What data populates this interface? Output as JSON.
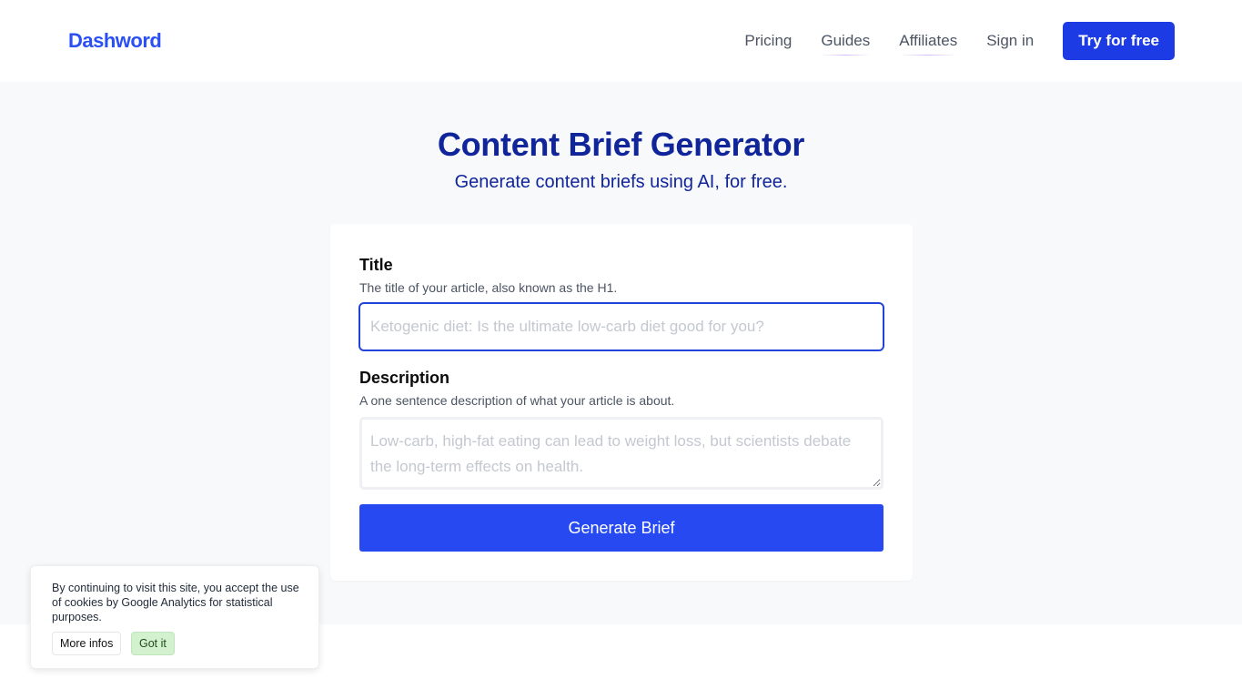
{
  "header": {
    "logo": "Dashword",
    "nav": [
      {
        "label": "Pricing"
      },
      {
        "label": "Guides"
      },
      {
        "label": "Affiliates"
      },
      {
        "label": "Sign in"
      }
    ],
    "cta": "Try for free"
  },
  "hero": {
    "title": "Content Brief Generator",
    "subtitle": "Generate content briefs using AI, for free."
  },
  "form": {
    "title_label": "Title",
    "title_hint": "The title of your article, also known as the H1.",
    "title_placeholder": "Ketogenic diet: Is the ultimate low-carb diet good for you?",
    "title_value": "",
    "description_label": "Description",
    "description_hint": "A one sentence description of what your article is about.",
    "description_placeholder": "Low-carb, high-fat eating can lead to weight loss, but scientists debate the long-term effects on health.",
    "description_value": "",
    "submit": "Generate Brief"
  },
  "cookie": {
    "text": "By continuing to visit this site, you accept the use of cookies by Google Analytics for statistical purposes.",
    "more": "More infos",
    "accept": "Got it"
  },
  "colors": {
    "brand": "#2a4ff5",
    "cta": "#1c3be5",
    "heading": "#10259a",
    "accept_bg": "#d3f0cf"
  }
}
